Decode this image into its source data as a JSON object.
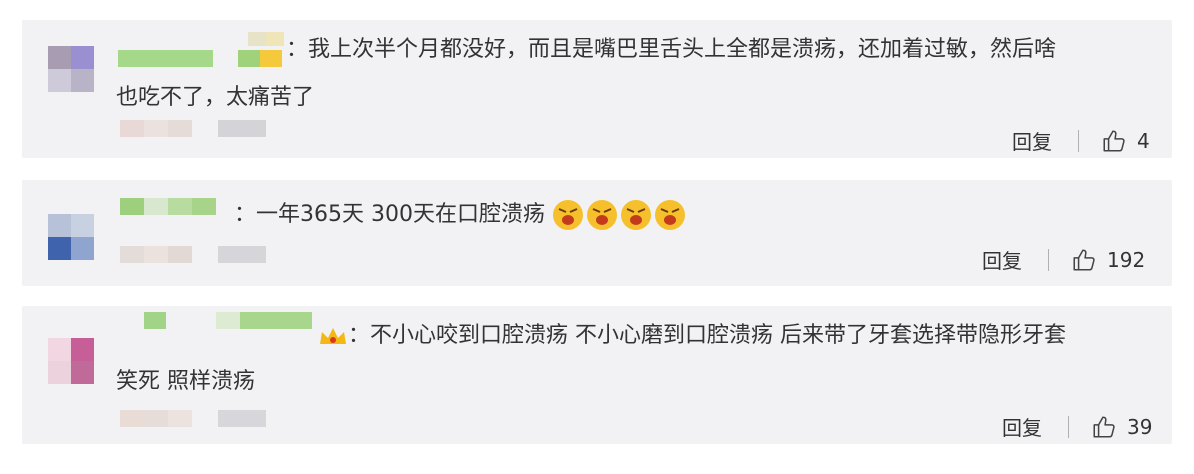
{
  "comments": [
    {
      "text_line1": "：我上次半个月都没好，而且是嘴巴里舌头上全都是溃疡，还加着过敏，然后啥",
      "text_line2": "也吃不了，太痛苦了",
      "reply_label": "回复",
      "like_count": "4"
    },
    {
      "text": "：一年365天 300天在口腔溃疡",
      "reply_label": "回复",
      "like_count": "192"
    },
    {
      "text_line1": "：不小心咬到口腔溃疡 不小心磨到口腔溃疡 后来带了牙套选择带隐形牙套",
      "text_line2": "笑死 照样溃疡",
      "reply_label": "回复",
      "like_count": "39"
    }
  ],
  "icons": {
    "like": "thumbs-up-icon",
    "emoji": "angry-face-icon",
    "badge": "crown-badge-icon"
  },
  "colors": {
    "card_background": "#f2f2f5",
    "text": "#333333",
    "divider": "#b0b0b0"
  }
}
